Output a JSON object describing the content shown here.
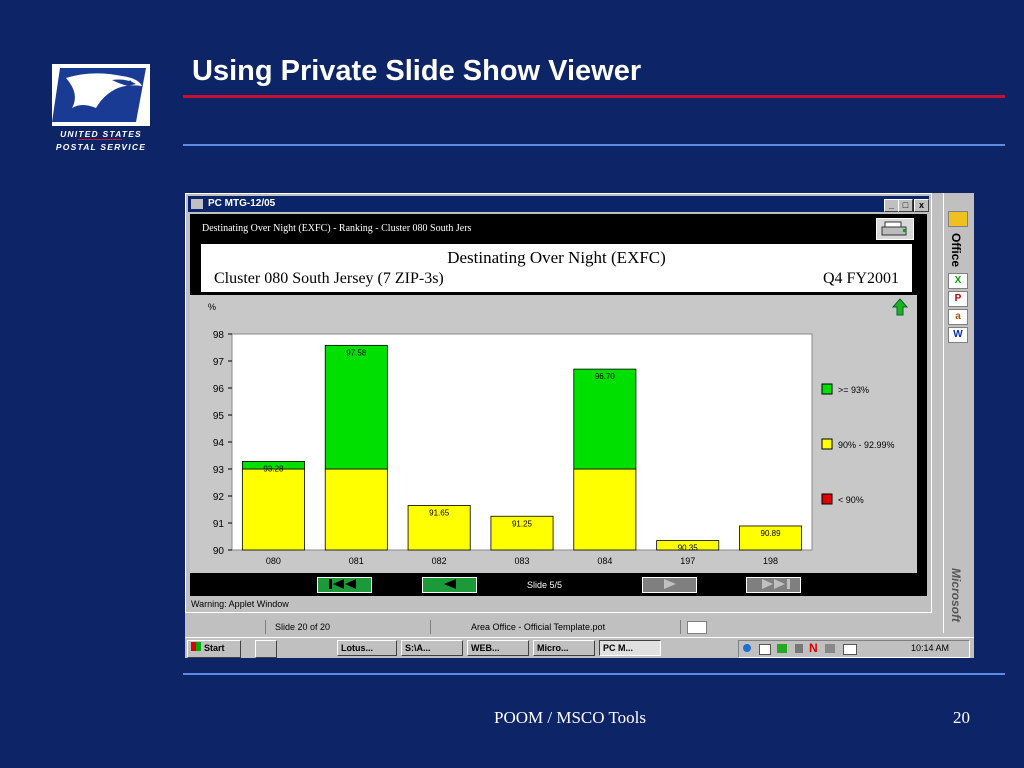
{
  "slide": {
    "title": "Using Private Slide Show Viewer",
    "logo_line1": "UNITED STATES",
    "logo_line2": "POSTAL SERVICE",
    "footer_center": "POOM / MSCO Tools",
    "page_number": "20"
  },
  "window": {
    "title": "PC MTG-12/05",
    "controls": [
      "_",
      "□",
      "x"
    ]
  },
  "applet": {
    "subtitle": "Destinating Over Night (EXFC) - Ranking - Cluster 080 South Jers",
    "header_title": "Destinating Over Night (EXFC)",
    "header_left": "Cluster 080 South Jersey (7 ZIP-3s)",
    "header_right": "Q4 FY2001",
    "slide_counter": "Slide 5/5",
    "status": "Warning: Applet Window"
  },
  "chart_data": {
    "type": "bar",
    "ylabel": "%",
    "ylim": [
      90,
      98
    ],
    "yticks": [
      90,
      91,
      92,
      93,
      94,
      95,
      96,
      97,
      98
    ],
    "categories": [
      "080",
      "081",
      "082",
      "083",
      "084",
      "197",
      "198"
    ],
    "values": [
      93.28,
      97.58,
      91.65,
      91.25,
      96.7,
      90.35,
      90.89
    ],
    "value_labels": [
      "93.28",
      "97.58",
      "91.65",
      "91.25",
      "96.70",
      "90.35",
      "90.89"
    ],
    "thresholds": [
      90,
      93
    ],
    "colors": {
      "high": "#00e000",
      "mid": "#ffff00",
      "low": "#e00000"
    },
    "legend": [
      {
        "label": ">= 93%",
        "color": "#00e000"
      },
      {
        "label": "90% - 92.99%",
        "color": "#ffff00"
      },
      {
        "label": "< 90%",
        "color": "#e00000"
      }
    ],
    "legend_position": "right",
    "grid": false
  },
  "ppt_status": {
    "slide": "Slide 20 of 20",
    "template": "Area Office - Official Template.pot"
  },
  "taskbar": {
    "start": "Start",
    "items": [
      "Lotus...",
      "S:\\A...",
      "WEB...",
      "Micro...",
      "PC M..."
    ],
    "clock": "10:14 AM"
  },
  "office_bar": {
    "label": "Office",
    "brand": "Microsoft"
  }
}
